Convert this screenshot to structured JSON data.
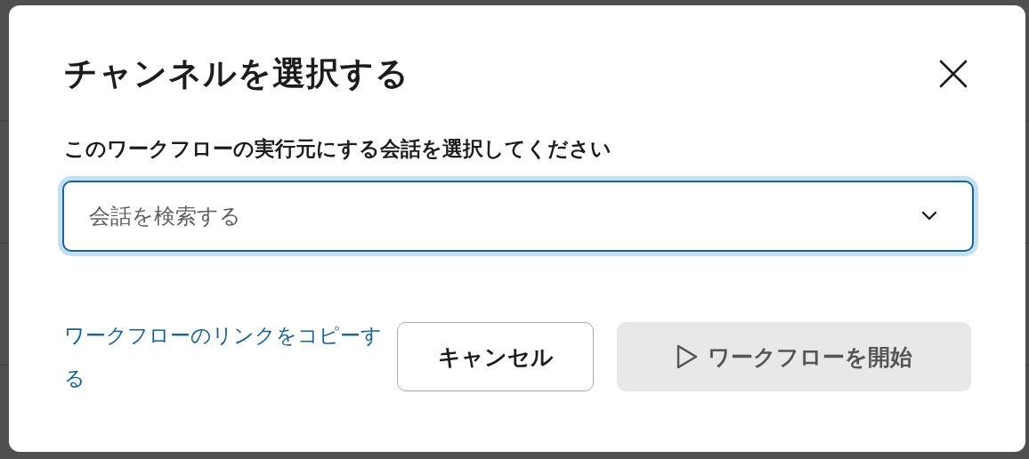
{
  "dialog": {
    "title": "チャンネルを選択する",
    "field": {
      "label": "このワークフローの実行元にする会話を選択してください",
      "placeholder": "会話を検索する",
      "focused": true
    },
    "link": "ワークフローのリンクをコピーする",
    "buttons": [
      {
        "kind": "secondary",
        "label": "キャンセル",
        "disabled": false
      },
      {
        "kind": "start",
        "label": "ワークフローを開始",
        "disabled": true
      }
    ]
  }
}
